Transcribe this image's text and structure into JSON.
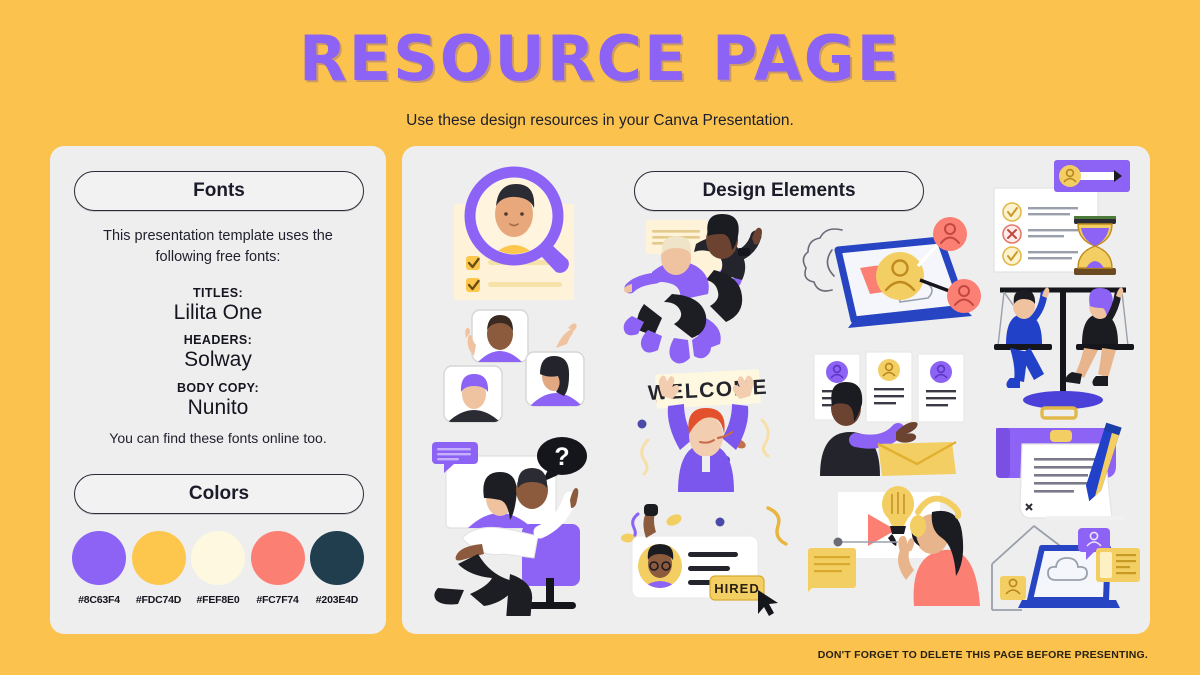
{
  "header": {
    "title": "RESOURCE PAGE",
    "subtitle": "Use these design resources in your Canva Presentation."
  },
  "fonts_panel": {
    "heading": "Fonts",
    "intro": "This presentation template uses the following free fonts:",
    "groups": [
      {
        "label": "TITLES:",
        "value": "Lilita One"
      },
      {
        "label": "HEADERS:",
        "value": "Solway"
      },
      {
        "label": "BODY COPY:",
        "value": "Nunito"
      }
    ],
    "outro": "You can find these fonts online too."
  },
  "colors_panel": {
    "heading": "Colors",
    "swatches": [
      {
        "hex": "#8C63F4"
      },
      {
        "hex": "#FDC74D"
      },
      {
        "hex": "#FEF8E0"
      },
      {
        "hex": "#FC7F74"
      },
      {
        "hex": "#203E4D"
      }
    ]
  },
  "elements_panel": {
    "heading": "Design Elements",
    "illustrations": [
      {
        "name": "magnifier-profile-checklist",
        "alt": "Magnifying glass over a person's portrait above a checklist card"
      },
      {
        "name": "video-call-portraits",
        "alt": "Three framed video call portraits with raised hands"
      },
      {
        "name": "seated-person-question",
        "alt": "Person reclining in a purple chair with a question mark bubble and video window"
      },
      {
        "name": "two-people-celebrating-document",
        "alt": "Two people floating beside a document and a purple check badge"
      },
      {
        "name": "welcome-banner-person",
        "alt": "Person holding a WELCOME banner with confetti"
      },
      {
        "name": "hired-profile-card",
        "alt": "Profile card with a HIRED badge and mouse cursor"
      },
      {
        "name": "laptop-network-users",
        "alt": "Laptop with connected user nodes and a gear outline"
      },
      {
        "name": "resume-review-envelope",
        "alt": "Person reviewing three resume cards beside an envelope"
      },
      {
        "name": "video-lesson-headphones",
        "alt": "Person with headphones watching a video with a lightbulb"
      },
      {
        "name": "checklist-hourglass-progress",
        "alt": "Checklist card with hourglass and purple progress bar"
      },
      {
        "name": "balance-scale-people",
        "alt": "Two people seated on a balance scale"
      },
      {
        "name": "briefcase-document-pen",
        "alt": "Purple briefcase with a document and blue pen"
      },
      {
        "name": "work-from-home-laptop",
        "alt": "House outline with a laptop showing a cloud and avatar cards"
      }
    ],
    "welcome_banner_text": "WELCOME",
    "hired_badge_text": "HIRED"
  },
  "footer": {
    "note": "DON'T FORGET TO DELETE THIS PAGE BEFORE PRESENTING."
  },
  "palette": {
    "background": "#FBC34D",
    "panel": "#EEEEEE",
    "purple": "#8C63F4",
    "yellow": "#FDC74D",
    "cream": "#FEF8E0",
    "salmon": "#FC7F74",
    "dark": "#203E4D",
    "ink": "#1b1b29"
  }
}
